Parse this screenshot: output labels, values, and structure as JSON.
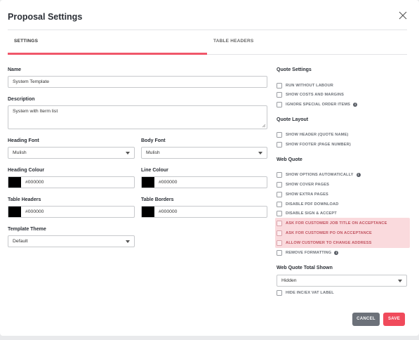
{
  "modal": {
    "title": "Proposal Settings"
  },
  "tabs": [
    {
      "label": "SETTINGS",
      "active": true
    },
    {
      "label": "TABLE HEADERS",
      "active": false
    }
  ],
  "form": {
    "name": {
      "label": "Name",
      "value": "System Template"
    },
    "description": {
      "label": "Description",
      "value": "System with Iterm list"
    },
    "heading_font": {
      "label": "Heading Font",
      "value": "Mulish"
    },
    "body_font": {
      "label": "Body Font",
      "value": "Mulish"
    },
    "heading_colour": {
      "label": "Heading Colour",
      "value": "#000000"
    },
    "line_colour": {
      "label": "Line Colour",
      "value": "#000000"
    },
    "table_headers": {
      "label": "Table Headers",
      "value": "#000000"
    },
    "table_borders": {
      "label": "Table Borders",
      "value": "#000000"
    },
    "template_theme": {
      "label": "Template Theme",
      "value": "Default"
    }
  },
  "quote_settings": {
    "title": "Quote Settings",
    "items": [
      {
        "label": "RUN WITHOUT LABOUR",
        "checked": false
      },
      {
        "label": "SHOW COSTS AND MARGINS",
        "checked": false
      },
      {
        "label": "IGNORE SPECIAL ORDER ITEMS",
        "checked": false,
        "info": true
      }
    ]
  },
  "quote_layout": {
    "title": "Quote Layout",
    "items": [
      {
        "label": "SHOW HEADER (QUOTE NAME)",
        "checked": false
      },
      {
        "label": "SHOW FOOTER (PAGE NUMBER)",
        "checked": false
      }
    ]
  },
  "web_quote": {
    "title": "Web Quote",
    "items": [
      {
        "label": "SHOW OPTIONS AUTOMATICALLY",
        "checked": false,
        "info": true
      },
      {
        "label": "SHOW COVER PAGES",
        "checked": false
      },
      {
        "label": "SHOW EXTRA PAGES",
        "checked": false
      },
      {
        "label": "DISABLE PDF DOWNLOAD",
        "checked": false
      },
      {
        "label": "DISABLE SIGN & ACCEPT",
        "checked": false
      },
      {
        "label": "ASK FOR CUSTOMER JOB TITLE ON ACCEPTANCE",
        "checked": false,
        "highlighted": true
      },
      {
        "label": "ASK FOR CUSTOMER PO ON ACCEPTANCE",
        "checked": false,
        "highlighted": true
      },
      {
        "label": "ALLOW CUSTOMER TO CHANGE ADDRESS",
        "checked": false,
        "highlighted": true
      },
      {
        "label": "REMOVE FORMATTING",
        "checked": false,
        "info": true
      }
    ]
  },
  "web_quote_total": {
    "title": "Web Quote Total Shown",
    "value": "Hidden",
    "extra": {
      "label": "HIDE INC/EX VAT LABEL",
      "checked": false
    }
  },
  "footer": {
    "cancel_label": "CANCEL",
    "save_label": "SAVE"
  },
  "colors": {
    "accent": "#f04a5b",
    "tab_underline": "#f0576a",
    "highlight": "#fadadd",
    "cancel": "#6c7179"
  }
}
